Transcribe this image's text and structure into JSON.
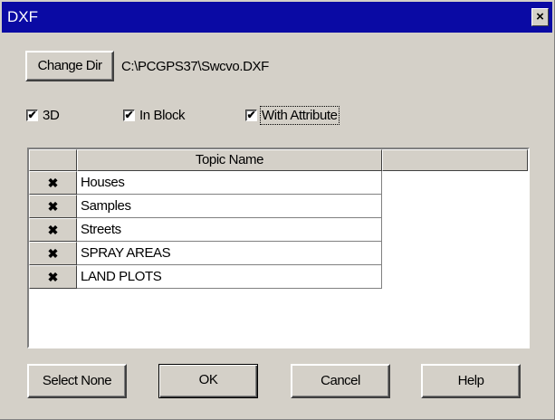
{
  "window": {
    "title": "DXF",
    "close_glyph": "×"
  },
  "toolbar": {
    "change_dir_label": "Change Dir",
    "path": "C:\\PCGPS37\\Swcvo.DXF"
  },
  "options": [
    {
      "label": "3D",
      "checked": true
    },
    {
      "label": "In Block",
      "checked": true
    },
    {
      "label": "With Attribute",
      "checked": true
    }
  ],
  "check_glyph": "✔",
  "table": {
    "columns": [
      "",
      "Topic Name",
      ""
    ],
    "rows": [
      {
        "mark": "✖",
        "name": "Houses"
      },
      {
        "mark": "✖",
        "name": "Samples"
      },
      {
        "mark": "✖",
        "name": "Streets"
      },
      {
        "mark": "✖",
        "name": "SPRAY AREAS"
      },
      {
        "mark": "✖",
        "name": "LAND PLOTS"
      }
    ]
  },
  "buttons": {
    "select_none": "Select None",
    "ok": "OK",
    "cancel": "Cancel",
    "help": "Help"
  }
}
